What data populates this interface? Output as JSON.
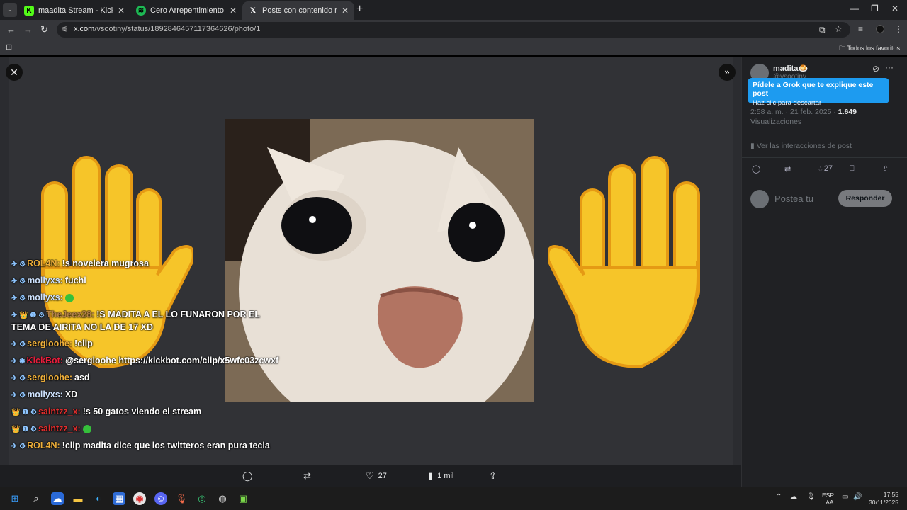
{
  "browser": {
    "tabs": [
      {
        "title": "maadita Stream - Kick Dashboard",
        "icon": "kick-icon",
        "color": "#53fc18",
        "active": false
      },
      {
        "title": "Cero Arrepentimiento • TheDaze",
        "icon": "spotify-icon",
        "color": "#1db954",
        "active": false
      },
      {
        "title": "Posts con contenido multimedia",
        "icon": "x-icon",
        "color": "#ffffff",
        "active": true
      }
    ],
    "url_domain": "x.com",
    "url_path": "/vsootiny/status/1892846457117364626/photo/1",
    "bookmarks_all": "Todos los favoritos"
  },
  "chat": [
    {
      "badges": "✈ ⚙",
      "user": "ROL4N:",
      "user_color": "#f0b03a",
      "text": "!s novelera mugrosa"
    },
    {
      "badges": "✈ ⚙",
      "user": "mollyxs:",
      "user_color": "#cfe3ff",
      "text": "fuchi"
    },
    {
      "badges": "✈ ⚙",
      "user": "mollyxs:",
      "user_color": "#cfe3ff",
      "text": "",
      "emote": true
    },
    {
      "badges": "✈ 👑 ❶ ⚙",
      "user": "TheJeex28:",
      "user_color": "#b5824a",
      "text": "!S MADITA A EL LO FUNARON POR EL TEMA DE AIRITA NO LA DE 17 XD"
    },
    {
      "badges": "✈ ⚙",
      "user": "sergioohe:",
      "user_color": "#f0b03a",
      "text": "!clip"
    },
    {
      "badges": "✈ ✱",
      "user": "KickBot:",
      "user_color": "#e91e3c",
      "text": "@sergioohe https://kickbot.com/clip/x5wfc03zcwxf"
    },
    {
      "badges": "✈ ⚙",
      "user": "sergioohe:",
      "user_color": "#f0b03a",
      "text": "asd"
    },
    {
      "badges": "✈ ⚙",
      "user": "mollyxs:",
      "user_color": "#cfe3ff",
      "text": "XD"
    },
    {
      "badges": "👑 ❶ ⚙",
      "user": "saintzz_x:",
      "user_color": "#e02d2d",
      "text": "!s 50 gatos viendo el stream"
    },
    {
      "badges": "👑 ❶ ⚙",
      "user": "saintzz_x:",
      "user_color": "#e02d2d",
      "text": "",
      "emote": true
    },
    {
      "badges": "✈ ⚙",
      "user": "ROL4N:",
      "user_color": "#f0b03a",
      "text": "!clip madita dice que los twitteros eran pura tecla"
    }
  ],
  "actions": {
    "likes": "27",
    "views": "1 mil"
  },
  "post": {
    "author": "madita🍮",
    "handle": "@vsootiny",
    "grok_title": "Pídele a Grok que te explique este post",
    "grok_sub": "Haz clic para descartar",
    "time": "2:58 a. m. · 21 feb. 2025 · ",
    "views_count": "1.649",
    "views_label": "Visualizaciones",
    "interactions": "Ver las interacciones de post",
    "likes": "27",
    "reply_placeholder": "Postea tu",
    "reply_button": "Responder"
  },
  "taskbar": {
    "lang1": "ESP",
    "lang2": "LAA",
    "time": "17:55",
    "date": "30/11/2025"
  }
}
